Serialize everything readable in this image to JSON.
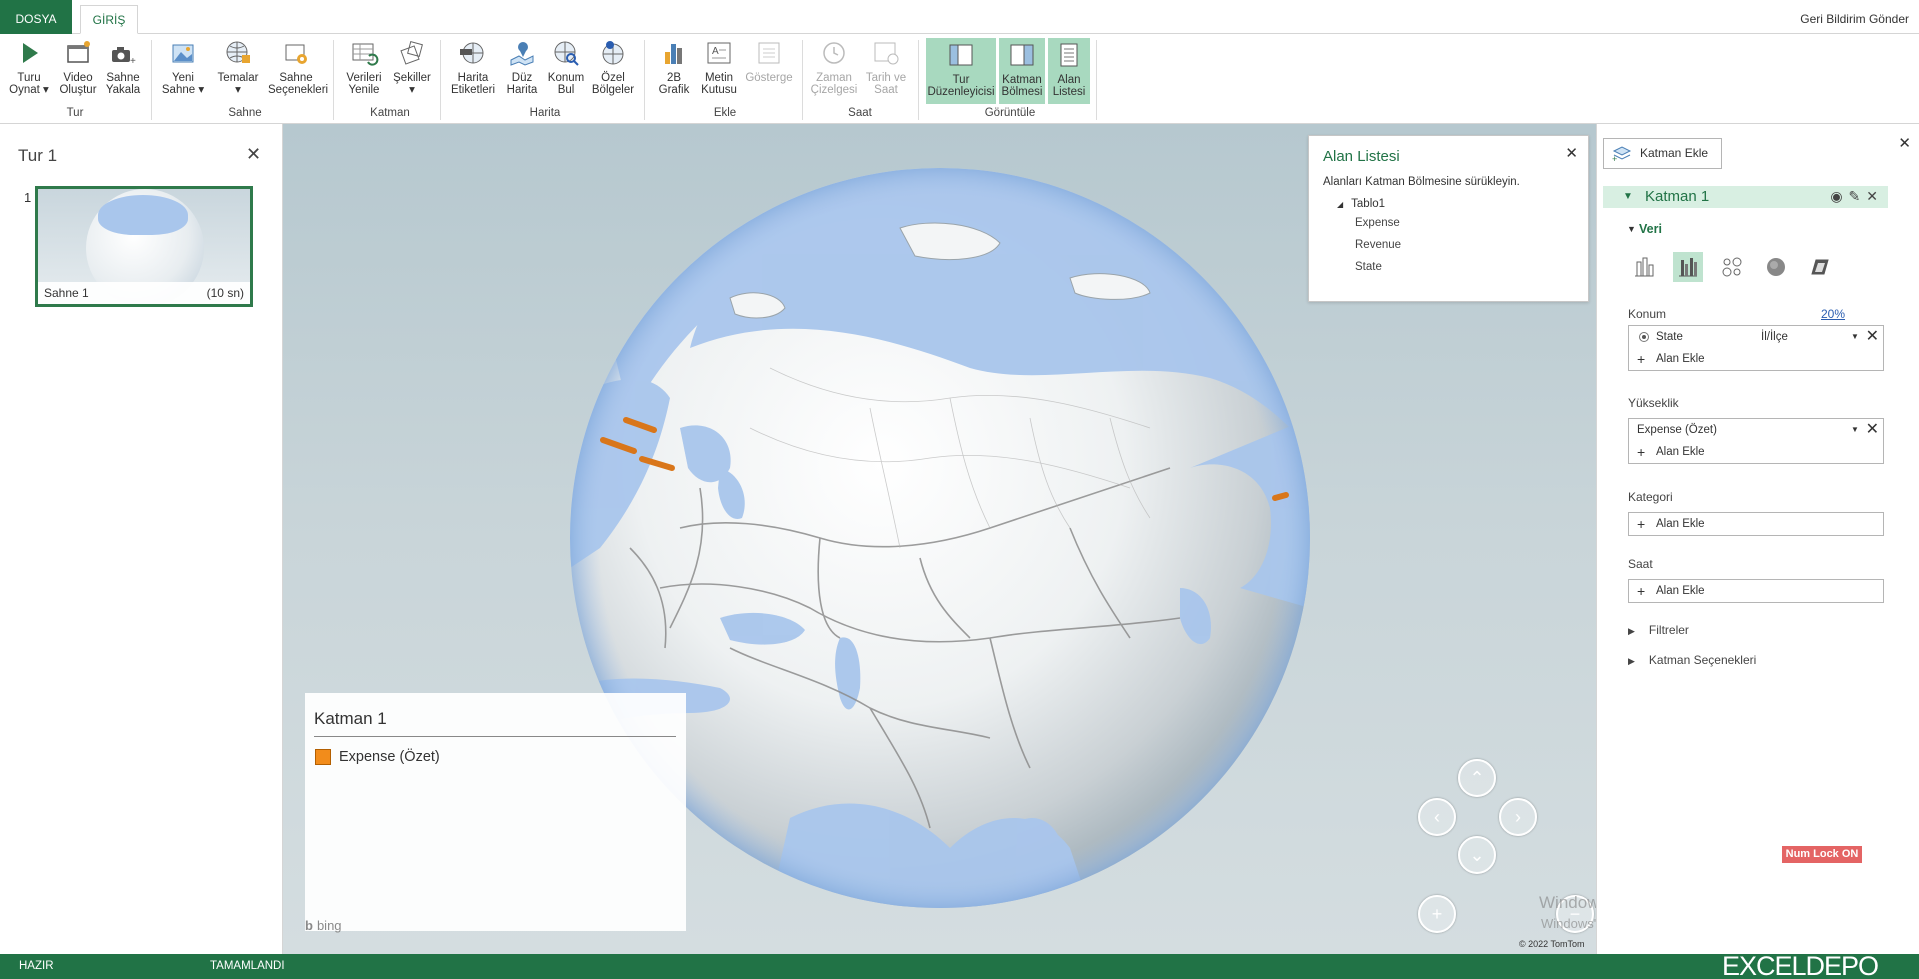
{
  "tabs": {
    "file": "DOSYA",
    "home": "GİRİŞ"
  },
  "feedback": "Geri Bildirim Gönder",
  "ribbon": {
    "groups": {
      "tur": "Tur",
      "sahne": "Sahne",
      "katman": "Katman",
      "harita": "Harita",
      "ekle": "Ekle",
      "saat": "Saat",
      "goruntule": "Görüntüle"
    },
    "buttons": {
      "play_tour_1": "Turu",
      "play_tour_2": "Oynat ▾",
      "video_1": "Video",
      "video_2": "Oluştur",
      "capture_1": "Sahne",
      "capture_2": "Yakala",
      "new_scene_1": "Yeni",
      "new_scene_2": "Sahne ▾",
      "themes_1": "Temalar",
      "themes_2": "▾",
      "scene_opts_1": "Sahne",
      "scene_opts_2": "Seçenekleri",
      "refresh_1": "Verileri",
      "refresh_2": "Yenile",
      "shapes_1": "Şekiller",
      "shapes_2": "▾",
      "map_labels_1": "Harita",
      "map_labels_2": "Etiketleri",
      "flat_map_1": "Düz",
      "flat_map_2": "Harita",
      "find_loc_1": "Konum",
      "find_loc_2": "Bul",
      "custom_reg_1": "Özel",
      "custom_reg_2": "Bölgeler",
      "chart2d_1": "2B",
      "chart2d_2": "Grafik",
      "textbox_1": "Metin",
      "textbox_2": "Kutusu",
      "legend_1": "Gösterge",
      "legend_2": "",
      "timeline_1": "Zaman",
      "timeline_2": "Çizelgesi",
      "datetime_1": "Tarih ve",
      "datetime_2": "Saat",
      "tour_editor_1": "Tur",
      "tour_editor_2": "Düzenleyicisi",
      "layer_pane_1": "Katman",
      "layer_pane_2": "Bölmesi",
      "field_list_1": "Alan",
      "field_list_2": "Listesi"
    }
  },
  "tour": {
    "title": "Tur 1",
    "scene_index": "1",
    "scene_name": "Sahne 1",
    "scene_duration": "(10 sn)"
  },
  "field_list": {
    "title": "Alan Listesi",
    "hint": "Alanları Katman Bölmesine sürükleyin.",
    "table": "Tablo1",
    "fields": [
      "Expense",
      "Revenue",
      "State"
    ]
  },
  "legend": {
    "title": "Katman 1",
    "item": "Expense (Özet)",
    "color": "#f28c1b"
  },
  "map": {
    "bing": "bing",
    "copyright": "© 2022 TomTom",
    "watermark_title": "Windows'u Etkinleştir",
    "watermark_text": "Windows'u etkinleştirmek için Ayarlar'a gidin."
  },
  "layer_pane": {
    "add_layer": "Katman Ekle",
    "layer_name": "Katman 1",
    "data_section": "Veri",
    "location_label": "Konum",
    "location_pct": "20%",
    "location_field": "State",
    "location_type": "İl/İlçe",
    "add_field": "Alan Ekle",
    "height_label": "Yükseklik",
    "height_field": "Expense (Özet)",
    "category_label": "Kategori",
    "time_label": "Saat",
    "filters": "Filtreler",
    "layer_options": "Katman Seçenekleri",
    "numlock": "Num Lock ON"
  },
  "status": {
    "ready": "HAZIR",
    "done": "TAMAMLANDI",
    "brand": "EXCELDEPO"
  },
  "colors": {
    "accent": "#217346",
    "bar": "#f28c1b",
    "ocean": "#a9c6ec"
  }
}
